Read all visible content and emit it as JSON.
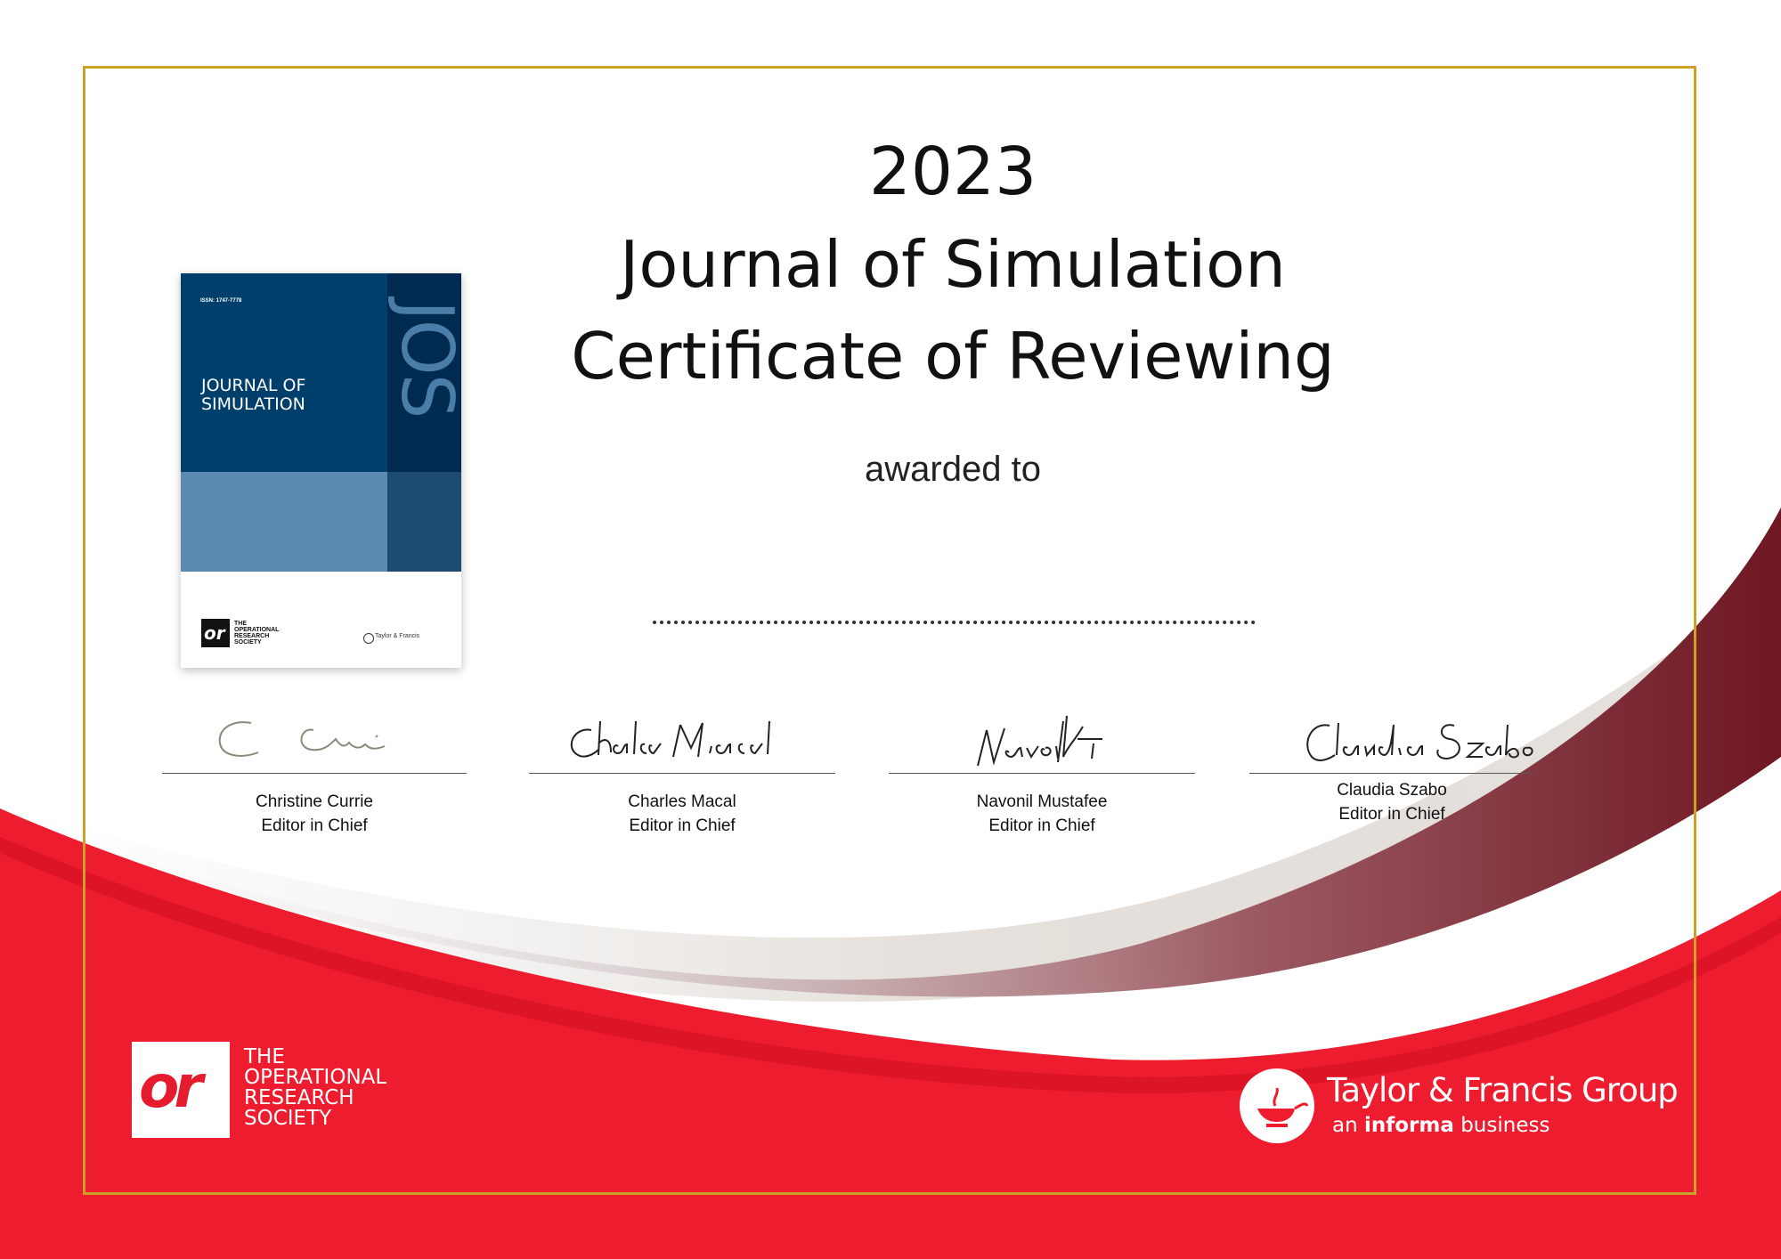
{
  "certificate": {
    "year": "2023",
    "journal": "Journal of Simulation",
    "certificate_title": "Certificate of Reviewing",
    "awarded_to": "awarded to"
  },
  "cover": {
    "issn": "ISSN: 1747-7778",
    "title": "JOURNAL OF\nSIMULATION",
    "spine_letters": "JOS",
    "society_logo": "or",
    "society_text": "THE\nOPERATIONAL\nRESEARCH\nSOCIETY",
    "publisher_text": "Taylor & Francis"
  },
  "signatories": [
    {
      "name": "Christine Currie",
      "role": "Editor in Chief"
    },
    {
      "name": "Charles Macal",
      "role": "Editor in Chief"
    },
    {
      "name": "Navonil Mustafee",
      "role": "Editor in Chief"
    },
    {
      "name": "Claudia Szabo",
      "role": "Editor in Chief"
    }
  ],
  "logos": {
    "or_mark": "or",
    "or_society": "THE\nOPERATIONAL\nRESEARCH\nSOCIETY",
    "tf_group": "Taylor & Francis Group",
    "tf_tag_prefix": "an ",
    "tf_tag_bold": "informa",
    "tf_tag_suffix": " business"
  },
  "colors": {
    "brand_red": "#e51b2e",
    "frame_gold": "#c9a227",
    "cover_blue": "#003f6b",
    "wave_maroon": "#7a1f2b"
  }
}
